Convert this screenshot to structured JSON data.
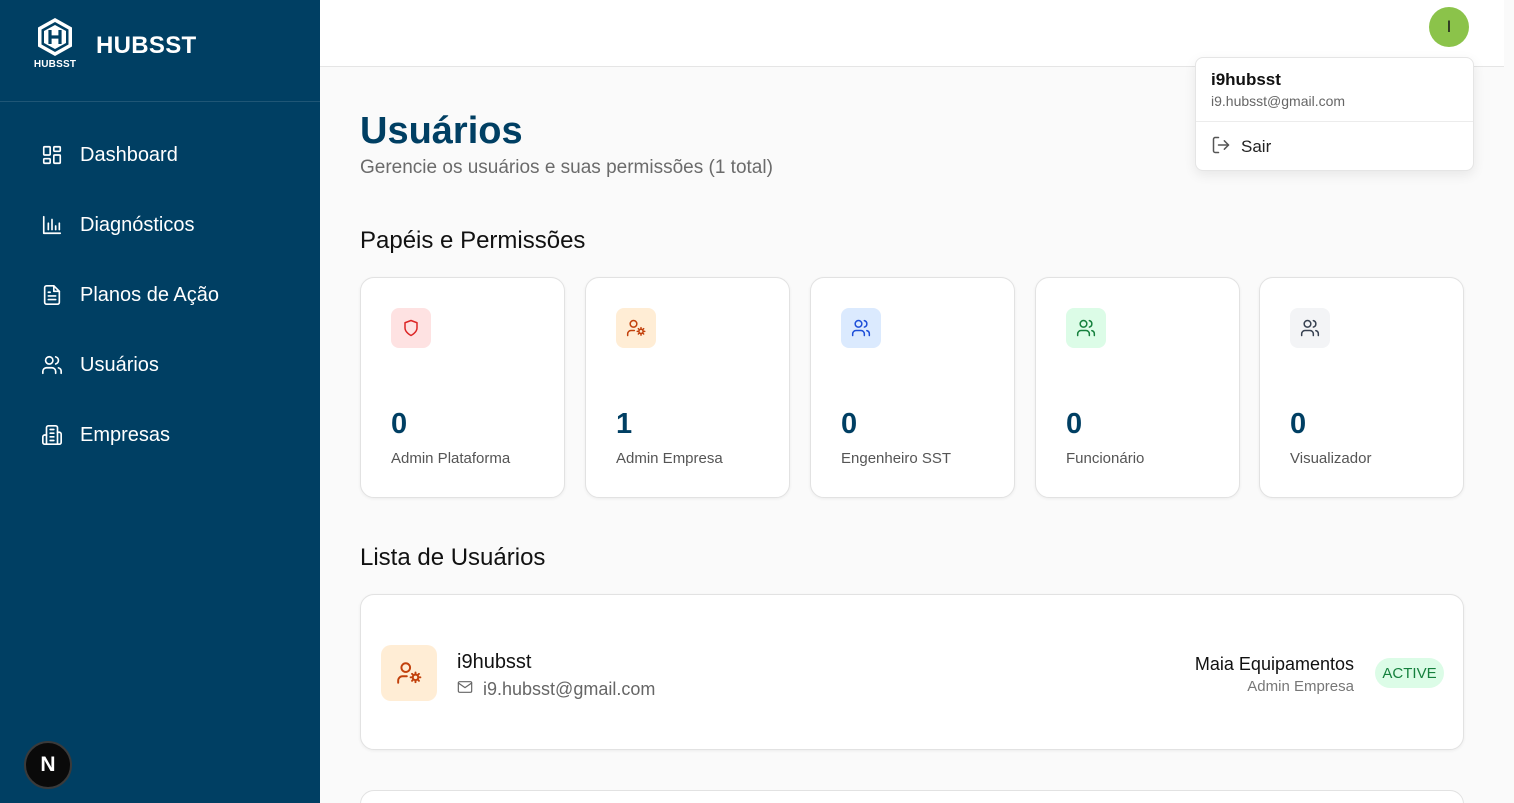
{
  "sidebar": {
    "logo_text": "HUBSST",
    "brand_title": "HUBSST",
    "items": [
      {
        "label": "Dashboard",
        "icon": "dashboard-icon"
      },
      {
        "label": "Diagnósticos",
        "icon": "bar-chart-icon"
      },
      {
        "label": "Planos de Ação",
        "icon": "document-icon"
      },
      {
        "label": "Usuários",
        "icon": "users-icon"
      },
      {
        "label": "Empresas",
        "icon": "building-icon"
      }
    ],
    "bottom_badge": "N"
  },
  "header": {
    "avatar_initial": "I"
  },
  "user_menu": {
    "name": "i9hubsst",
    "email": "i9.hubsst@gmail.com",
    "logout_label": "Sair"
  },
  "main": {
    "title": "Usuários",
    "subtitle": "Gerencie os usuários e suas permissões (1 total)",
    "roles_title": "Papéis e Permissões",
    "roles": [
      {
        "count": "0",
        "label": "Admin Plataforma",
        "icon": "shield-icon",
        "bg": "#fee2e2",
        "fg": "#dc2626"
      },
      {
        "count": "1",
        "label": "Admin Empresa",
        "icon": "user-cog-icon",
        "bg": "#ffedd5",
        "fg": "#c2410c"
      },
      {
        "count": "0",
        "label": "Engenheiro SST",
        "icon": "users-icon",
        "bg": "#dbeafe",
        "fg": "#1d4ed8"
      },
      {
        "count": "0",
        "label": "Funcionário",
        "icon": "users-icon",
        "bg": "#dcfce7",
        "fg": "#15803d"
      },
      {
        "count": "0",
        "label": "Visualizador",
        "icon": "users-icon",
        "bg": "#f3f4f6",
        "fg": "#374151"
      }
    ],
    "list_title": "Lista de Usuários",
    "users": [
      {
        "name": "i9hubsst",
        "email": "i9.hubsst@gmail.com",
        "company": "Maia Equipamentos",
        "role": "Admin Empresa",
        "status": "ACTIVE"
      }
    ]
  },
  "colors": {
    "sidebar_bg": "#003f63",
    "accent": "#003f63",
    "avatar_bg": "#8bc34a",
    "status_active_bg": "#dcfce7",
    "status_active_fg": "#15803d"
  }
}
